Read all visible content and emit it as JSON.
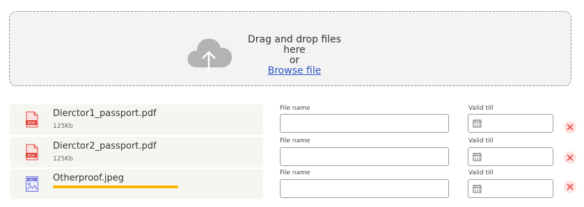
{
  "dropzone": {
    "line1": "Drag and drop files here",
    "line2": "or",
    "browse_label": "Browse file"
  },
  "files": [
    {
      "name": "Dierctor1_passport.pdf",
      "size": "125Kb",
      "type_badge": "PDF",
      "icon": "pdf-file-icon"
    },
    {
      "name": "Dierctor2_passport.pdf",
      "size": "125Kb",
      "type_badge": "PDF",
      "icon": "pdf-file-icon"
    },
    {
      "name": "Otherproof.jpeg",
      "type_badge": "JPEG",
      "icon": "jpeg-file-icon",
      "upload_progress": 1.0
    }
  ],
  "form": {
    "file_name_label": "File name",
    "valid_till_label": "Valid till",
    "file_name_value": "",
    "valid_till_value": ""
  },
  "colors": {
    "pdf": "#e0433b",
    "jpeg": "#6b6fd8",
    "progress": "#f7b500",
    "remove": "#e94a4a",
    "link": "#2b55c4"
  },
  "icons": {
    "upload": "cloud-upload-icon",
    "calendar": "calendar-icon",
    "remove": "close-icon"
  }
}
